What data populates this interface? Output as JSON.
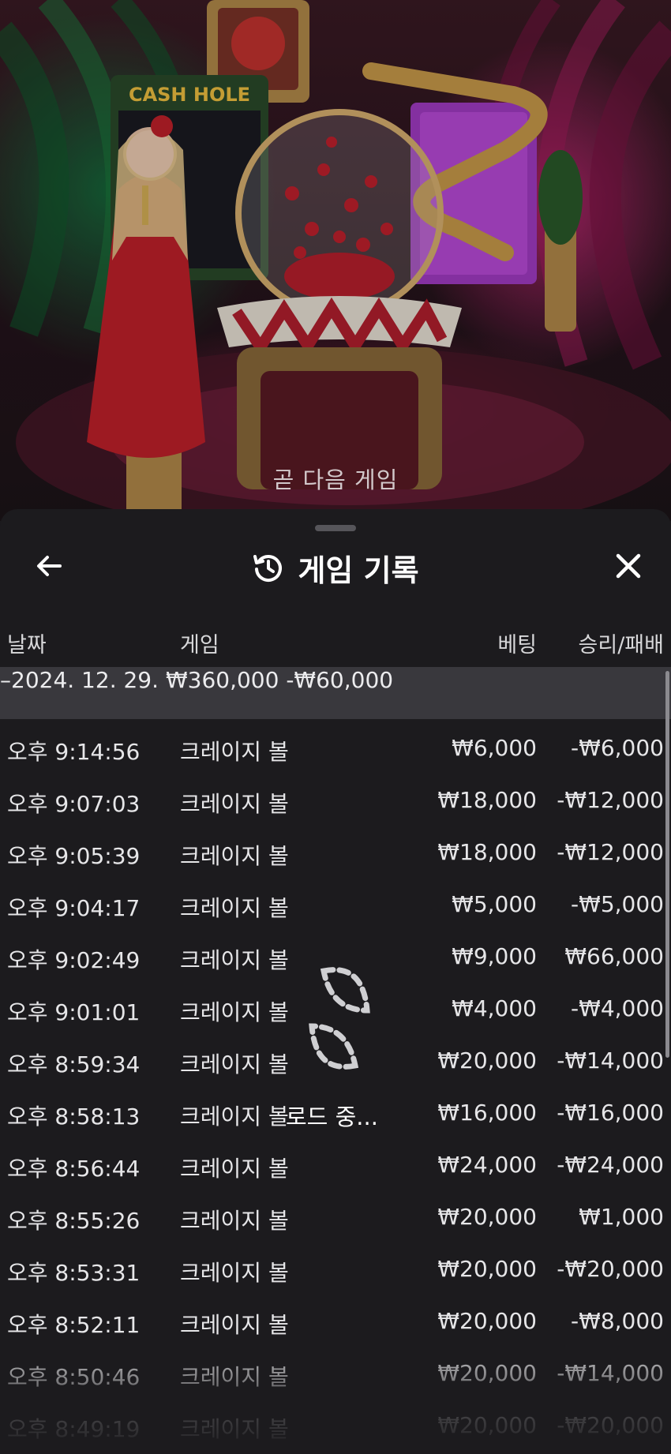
{
  "scene": {
    "caption": "곧 다음 게임",
    "sign_text": "CASH HOLE"
  },
  "header": {
    "title": "게임 기록",
    "back_icon": "arrow-left-icon",
    "history_icon": "history-icon",
    "close_icon": "close-icon"
  },
  "columns": {
    "date": "날짜",
    "game": "게임",
    "bet": "베팅",
    "result": "승리/패배"
  },
  "summary": {
    "date": "–2024. 12. 29.",
    "bet": "₩360,000",
    "result": "-₩60,000"
  },
  "rows": [
    {
      "time": "오후 9:14:56",
      "game": "크레이지 볼",
      "bet": "₩6,000",
      "result": "-₩6,000"
    },
    {
      "time": "오후 9:07:03",
      "game": "크레이지 볼",
      "bet": "₩18,000",
      "result": "-₩12,000"
    },
    {
      "time": "오후 9:05:39",
      "game": "크레이지 볼",
      "bet": "₩18,000",
      "result": "-₩12,000"
    },
    {
      "time": "오후 9:04:17",
      "game": "크레이지 볼",
      "bet": "₩5,000",
      "result": "-₩5,000"
    },
    {
      "time": "오후 9:02:49",
      "game": "크레이지 볼",
      "bet": "₩9,000",
      "result": "₩66,000"
    },
    {
      "time": "오후 9:01:01",
      "game": "크레이지 볼",
      "bet": "₩4,000",
      "result": "-₩4,000"
    },
    {
      "time": "오후 8:59:34",
      "game": "크레이지 볼",
      "bet": "₩20,000",
      "result": "-₩14,000"
    },
    {
      "time": "오후 8:58:13",
      "game": "크레이지 볼",
      "bet": "₩16,000",
      "result": "-₩16,000"
    },
    {
      "time": "오후 8:56:44",
      "game": "크레이지 볼",
      "bet": "₩24,000",
      "result": "-₩24,000"
    },
    {
      "time": "오후 8:55:26",
      "game": "크레이지 볼",
      "bet": "₩20,000",
      "result": "₩1,000"
    },
    {
      "time": "오후 8:53:31",
      "game": "크레이지 볼",
      "bet": "₩20,000",
      "result": "-₩20,000"
    },
    {
      "time": "오후 8:52:11",
      "game": "크레이지 볼",
      "bet": "₩20,000",
      "result": "-₩8,000"
    },
    {
      "time": "오후 8:50:46",
      "game": "크레이지 볼",
      "bet": "₩20,000",
      "result": "-₩14,000"
    },
    {
      "time": "오후 8:49:19",
      "game": "크레이지 볼",
      "bet": "₩20,000",
      "result": "-₩20,000"
    }
  ],
  "loading": {
    "text": "로드 중...",
    "icon": "loading-spinner-icon"
  }
}
